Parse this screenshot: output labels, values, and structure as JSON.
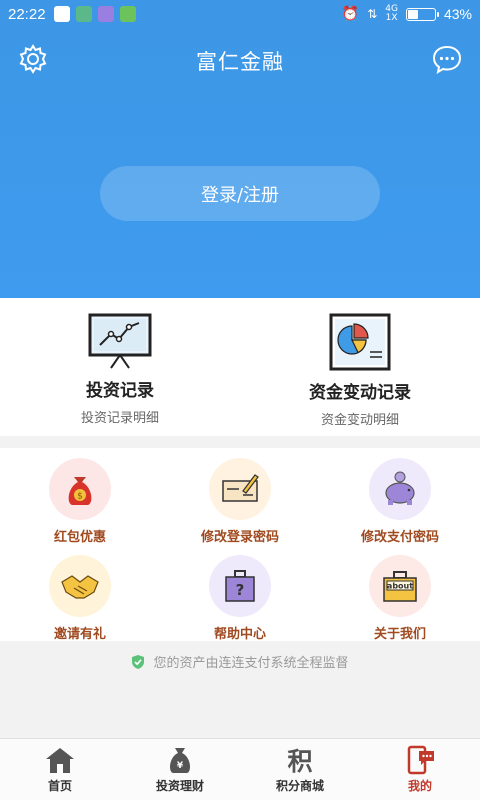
{
  "status_bar": {
    "time": "22:22",
    "signal": "4G",
    "signal2": "1X",
    "battery_percent": "43%",
    "battery_level": 0.43
  },
  "header": {
    "title": "富仁金融",
    "login_label": "登录/注册"
  },
  "records": [
    {
      "title": "投资记录",
      "subtitle": "投资记录明细"
    },
    {
      "title": "资金变动记录",
      "subtitle": "资金变动明细"
    }
  ],
  "grid": [
    {
      "label": "红包优惠",
      "icon": "money-bag-icon",
      "color": "#fde7e6"
    },
    {
      "label": "修改登录密码",
      "icon": "edit-check-icon",
      "color": "#fff2e0"
    },
    {
      "label": "修改支付密码",
      "icon": "piggy-bank-icon",
      "color": "#efeafb"
    },
    {
      "label": "邀请有礼",
      "icon": "handshake-icon",
      "color": "#fff4d9"
    },
    {
      "label": "帮助中心",
      "icon": "help-briefcase-icon",
      "color": "#efeafb"
    },
    {
      "label": "关于我们",
      "icon": "about-box-icon",
      "color": "#fdeae6"
    }
  ],
  "notice": "您的资产由连连支付系统全程监督",
  "nav": {
    "home": "首页",
    "invest": "投资理财",
    "mall": "积分商城",
    "mine": "我的"
  }
}
